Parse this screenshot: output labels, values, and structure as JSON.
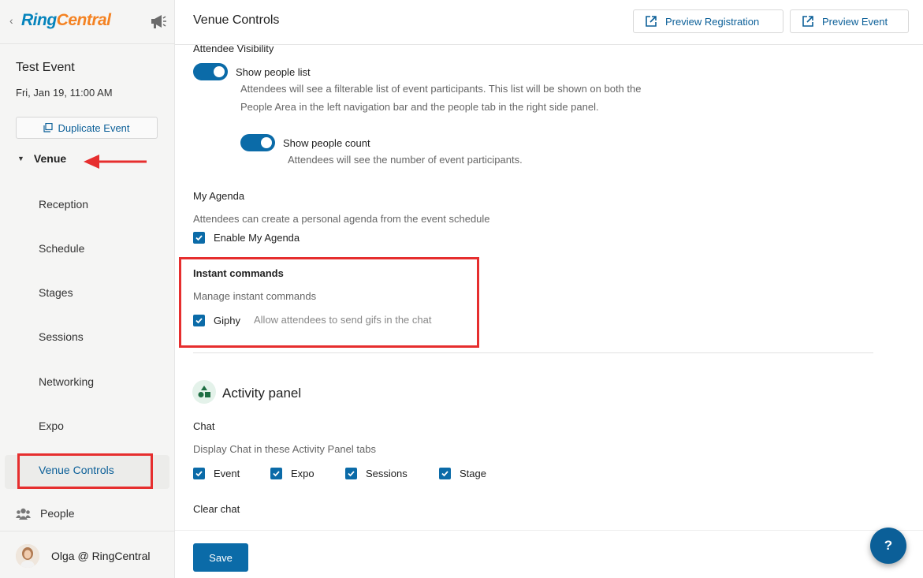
{
  "brand": {
    "ring": "Ring",
    "central": "Central",
    "megaphone_icon": "megaphone-icon"
  },
  "sidebar": {
    "event_title": "Test Event",
    "event_date": "Fri, Jan 19, 11:00 AM",
    "duplicate_label": "Duplicate Event",
    "venue_label": "Venue",
    "items": [
      {
        "label": "Reception"
      },
      {
        "label": "Schedule"
      },
      {
        "label": "Stages"
      },
      {
        "label": "Sessions"
      },
      {
        "label": "Networking"
      },
      {
        "label": "Expo"
      },
      {
        "label": "Venue Controls",
        "active": true
      }
    ],
    "people_label": "People",
    "user_name": "Olga @ RingCentral"
  },
  "header": {
    "title": "Venue Controls",
    "preview_registration": "Preview Registration",
    "preview_event": "Preview Event"
  },
  "attendee_visibility": {
    "title": "Attendee Visibility",
    "show_people_list": {
      "label": "Show people list",
      "on": true
    },
    "people_list_desc_1": "Attendees will see a filterable list of event participants. This list will be shown on both the",
    "people_list_desc_2": "People Area in the left navigation bar and the people tab in the right side panel.",
    "show_people_count": {
      "label": "Show people count",
      "on": true
    },
    "people_count_desc": "Attendees will see the number of event participants."
  },
  "my_agenda": {
    "title": "My Agenda",
    "desc": "Attendees can create a personal agenda from the event schedule",
    "checkbox_label": "Enable My Agenda"
  },
  "instant_commands": {
    "title": "Instant commands",
    "desc": "Manage instant commands",
    "giphy_label": "Giphy",
    "giphy_desc": "Allow attendees to send gifs in the chat"
  },
  "activity_panel": {
    "title": "Activity panel",
    "chat_title": "Chat",
    "chat_desc": "Display Chat in these Activity Panel tabs",
    "tabs": [
      "Event",
      "Expo",
      "Sessions",
      "Stage"
    ],
    "clear_chat_title": "Clear chat"
  },
  "footer": {
    "save_label": "Save",
    "help_label": "?"
  },
  "colors": {
    "accent": "#0b6ba8",
    "link": "#0b5f98",
    "highlight": "#e62e2e",
    "brand_blue": "#0684bc",
    "brand_orange": "#f48222"
  }
}
